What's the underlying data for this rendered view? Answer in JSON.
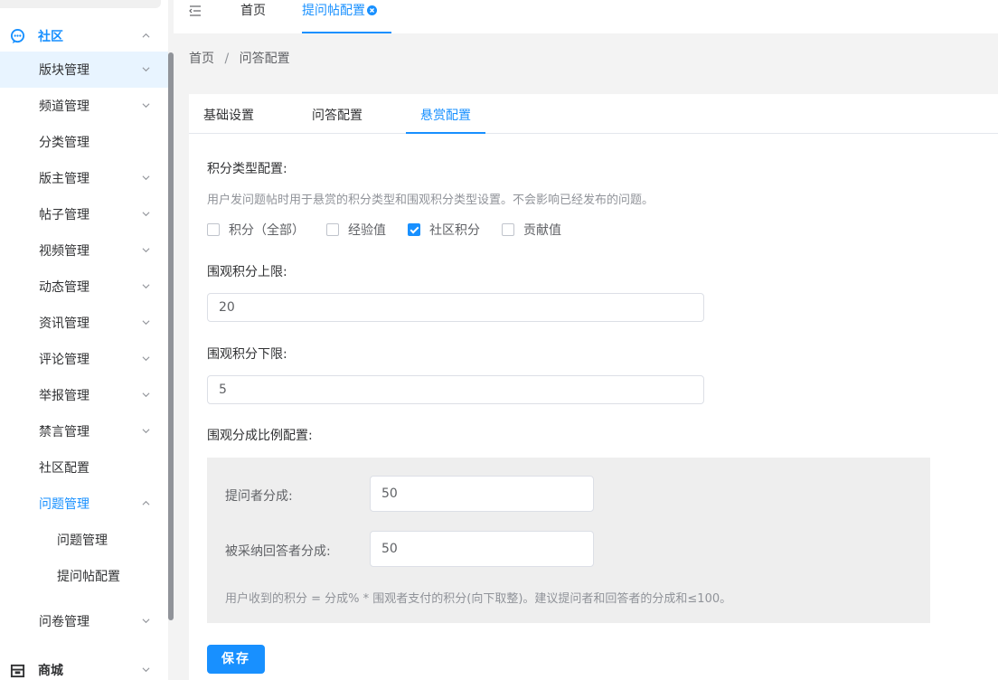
{
  "sidebar": {
    "community": "社区",
    "items": [
      {
        "label": "版块管理"
      },
      {
        "label": "频道管理"
      },
      {
        "label": "分类管理"
      },
      {
        "label": "版主管理"
      },
      {
        "label": "帖子管理"
      },
      {
        "label": "视频管理"
      },
      {
        "label": "动态管理"
      },
      {
        "label": "资讯管理"
      },
      {
        "label": "评论管理"
      },
      {
        "label": "举报管理"
      },
      {
        "label": "禁言管理"
      },
      {
        "label": "社区配置"
      },
      {
        "label": "问题管理"
      }
    ],
    "subitems": [
      {
        "label": "问题管理"
      },
      {
        "label": "提问帖配置"
      }
    ],
    "survey": "问卷管理",
    "mall": "商城"
  },
  "topbar": {
    "home_tab": "首页",
    "current_tab": "提问帖配置"
  },
  "breadcrumb": {
    "home": "首页",
    "sep": "/",
    "current": "问答配置"
  },
  "tabs": [
    "基础设置",
    "问答配置",
    "悬赏配置"
  ],
  "form": {
    "type_label": "积分类型配置:",
    "type_hint": "用户发问题帖时用于悬赏的积分类型和围观积分类型设置。不会影响已经发布的问题。",
    "checkboxes": [
      {
        "label": "积分（全部）",
        "checked": false
      },
      {
        "label": "经验值",
        "checked": false
      },
      {
        "label": "社区积分",
        "checked": true
      },
      {
        "label": "贡献值",
        "checked": false
      }
    ],
    "upper_label": "围观积分上限:",
    "upper_value": "20",
    "lower_label": "围观积分下限:",
    "lower_value": "5",
    "ratio_label": "围观分成比例配置:",
    "asker_label": "提问者分成:",
    "asker_value": "50",
    "answerer_label": "被采纳回答者分成:",
    "answerer_value": "50",
    "ratio_hint": "用户收到的积分 = 分成% * 围观者支付的积分(向下取整)。建议提问者和回答者的分成和≤100。",
    "save": "保存"
  },
  "colors": {
    "accent": "#1890ff"
  }
}
